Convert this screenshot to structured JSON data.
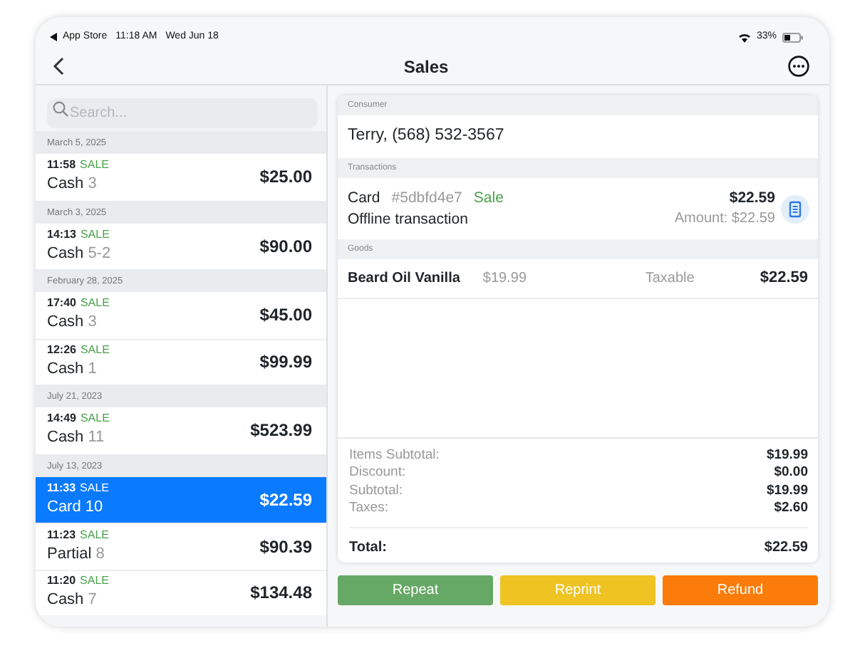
{
  "status_bar": {
    "back_app": "App Store",
    "time": "11:18 AM",
    "date": "Wed Jun 18",
    "battery": "33%"
  },
  "nav": {
    "title": "Sales"
  },
  "search": {
    "placeholder": "Search..."
  },
  "groups": [
    {
      "date": "March 5, 2025",
      "rows": [
        {
          "time": "11:58",
          "type": "SALE",
          "method": "Cash",
          "number": "3",
          "amount": "$25.00",
          "selected": false
        }
      ]
    },
    {
      "date": "March 3, 2025",
      "rows": [
        {
          "time": "14:13",
          "type": "SALE",
          "method": "Cash",
          "number": "5-2",
          "amount": "$90.00",
          "selected": false
        }
      ]
    },
    {
      "date": "February 28, 2025",
      "rows": [
        {
          "time": "17:40",
          "type": "SALE",
          "method": "Cash",
          "number": "3",
          "amount": "$45.00",
          "selected": false
        },
        {
          "time": "12:26",
          "type": "SALE",
          "method": "Cash",
          "number": "1",
          "amount": "$99.99",
          "selected": false
        }
      ]
    },
    {
      "date": "July 21, 2023",
      "rows": [
        {
          "time": "14:49",
          "type": "SALE",
          "method": "Cash",
          "number": "11",
          "amount": "$523.99",
          "selected": false
        }
      ]
    },
    {
      "date": "July 13, 2023",
      "rows": [
        {
          "time": "11:33",
          "type": "SALE",
          "method": "Card",
          "number": "10",
          "amount": "$22.59",
          "selected": true
        },
        {
          "time": "11:23",
          "type": "SALE",
          "method": "Partial",
          "number": "8",
          "amount": "$90.39",
          "selected": false
        },
        {
          "time": "11:20",
          "type": "SALE",
          "method": "Cash",
          "number": "7",
          "amount": "$134.48",
          "selected": false
        }
      ]
    }
  ],
  "detail": {
    "consumer": {
      "header": "Consumer",
      "value": "Terry, (568) 532-3567"
    },
    "transactions": {
      "header": "Transactions",
      "items": [
        {
          "method": "Card",
          "id": "#5dbfd4e7",
          "type": "Sale",
          "description": "Offline transaction",
          "amount": "$22.59",
          "amount_line": "Amount: $22.59"
        }
      ]
    },
    "goods": {
      "header": "Goods",
      "items": [
        {
          "name": "Beard Oil Vanilla",
          "price": "$19.99",
          "tax": "Taxable",
          "total": "$22.59"
        }
      ]
    },
    "totals": [
      {
        "label": "Items Subtotal:",
        "value": "$19.99"
      },
      {
        "label": "Discount:",
        "value": "$0.00"
      },
      {
        "label": "Subtotal:",
        "value": "$19.99"
      },
      {
        "label": "Taxes:",
        "value": "$2.60"
      }
    ],
    "total": {
      "label": "Total:",
      "value": "$22.59"
    }
  },
  "buttons": [
    {
      "label": "Repeat",
      "color": "#66a866"
    },
    {
      "label": "Reprint",
      "color": "#eec322"
    },
    {
      "label": "Refund",
      "color": "#fb7c0a"
    }
  ]
}
